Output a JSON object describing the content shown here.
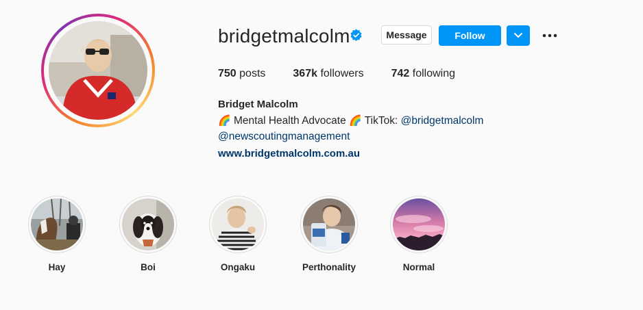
{
  "profile": {
    "username": "bridgetmalcolm",
    "verified_icon": "verified-badge-icon",
    "message_label": "Message",
    "follow_label": "Follow",
    "dropdown_icon": "chevron-down-icon",
    "more_icon": "more-options-icon",
    "accent_color": "#0095f6"
  },
  "stats": {
    "posts_count": "750",
    "posts_label": "posts",
    "followers_count": "367k",
    "followers_label": "followers",
    "following_count": "742",
    "following_label": "following"
  },
  "bio": {
    "full_name": "Bridget Malcolm",
    "emoji": "🌈",
    "text1": "Mental Health Advocate",
    "text2": "TikTok:",
    "tiktok_handle": "@bridgetmalcolm",
    "agency_handle": "@newscoutingmanagement",
    "website": "www.bridgetmalcolm.com.au"
  },
  "highlights": [
    {
      "label": "Hay"
    },
    {
      "label": "Boi"
    },
    {
      "label": "Ongaku"
    },
    {
      "label": "Perthonality"
    },
    {
      "label": "Normal"
    }
  ]
}
